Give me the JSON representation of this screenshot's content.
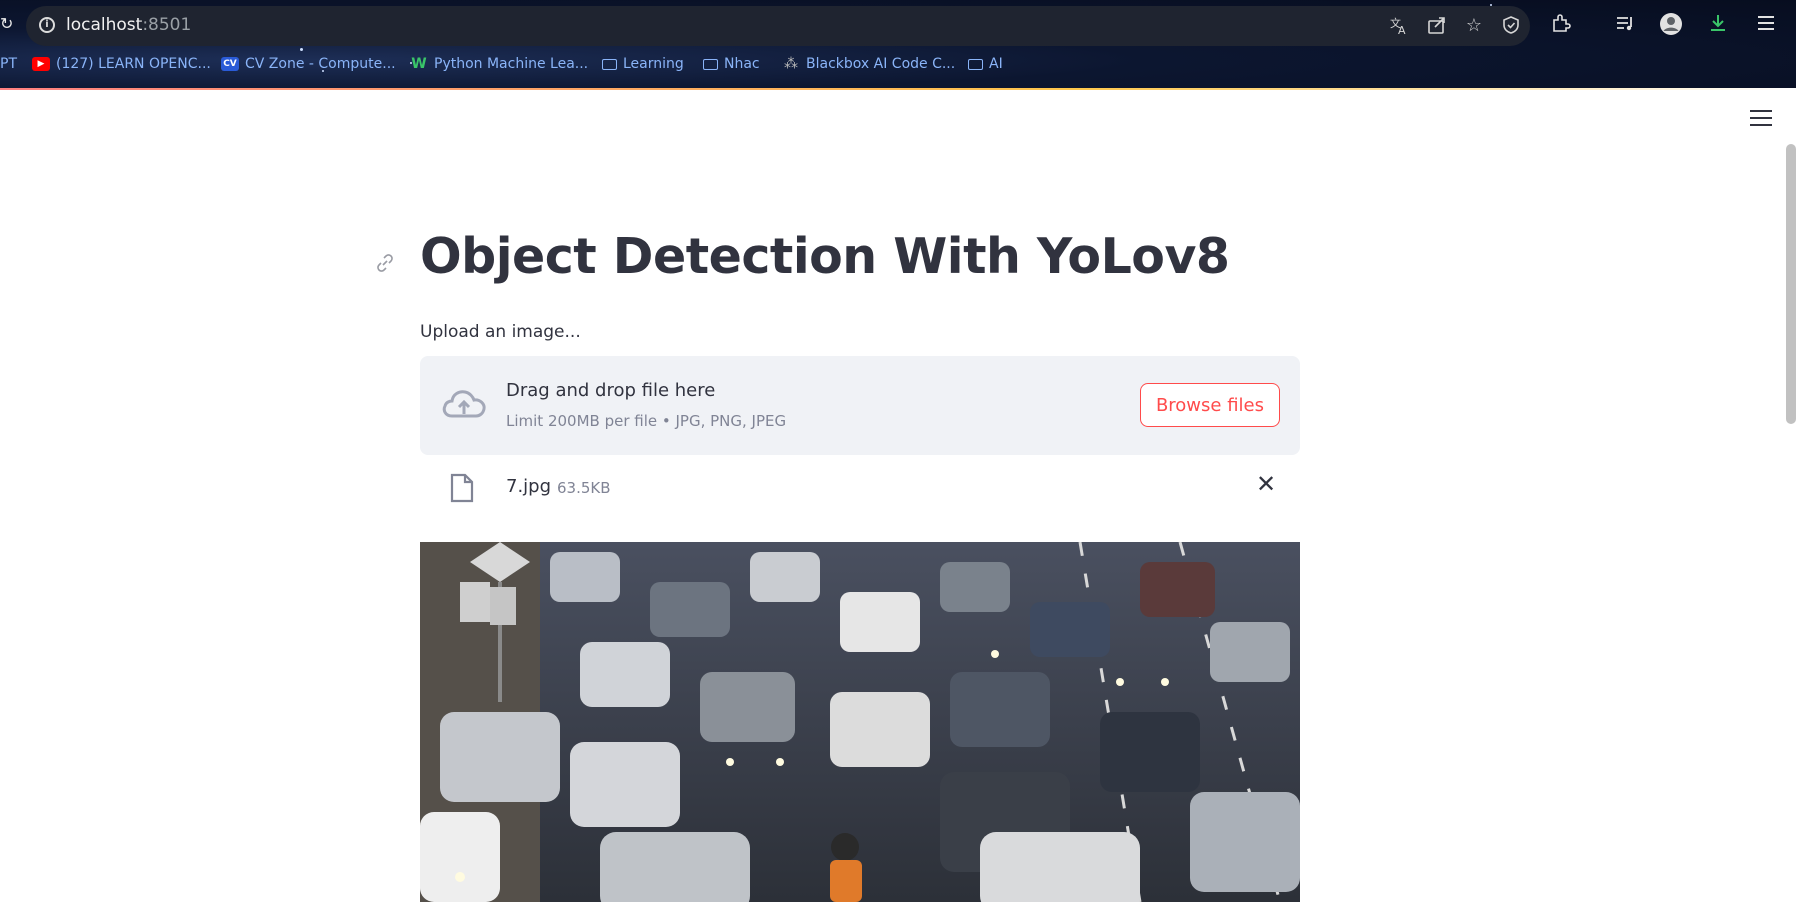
{
  "browser": {
    "url_host": "localhost",
    "url_port": ":8501",
    "left_edge_text": "C",
    "bookmarks": [
      {
        "icon": "text",
        "label": "PT"
      },
      {
        "icon": "youtube-icon",
        "label": "(127) LEARN OPENC..."
      },
      {
        "icon": "cv-icon",
        "label": "CV Zone - Compute..."
      },
      {
        "icon": "w-icon",
        "label": "Python Machine Lea..."
      },
      {
        "icon": "folder-icon",
        "label": "Learning"
      },
      {
        "icon": "folder-icon",
        "label": "Nhac"
      },
      {
        "icon": "blackbox-icon",
        "label": "Blackbox AI Code C..."
      },
      {
        "icon": "folder-icon",
        "label": "AI"
      }
    ]
  },
  "app": {
    "title": "Object Detection With YoLov8",
    "uploader": {
      "label": "Upload an image...",
      "drop_text": "Drag and drop file here",
      "limit_text": "Limit 200MB per file • JPG, PNG, JPEG",
      "browse_label": "Browse files"
    },
    "file": {
      "name": "7.jpg",
      "size": "63.5KB"
    },
    "preview": {
      "description_icon": "image-preview"
    }
  },
  "colors": {
    "accent": "#ff4b4b",
    "text": "#31333f",
    "muted": "#808495",
    "dropzone_bg": "#f0f2f6"
  }
}
